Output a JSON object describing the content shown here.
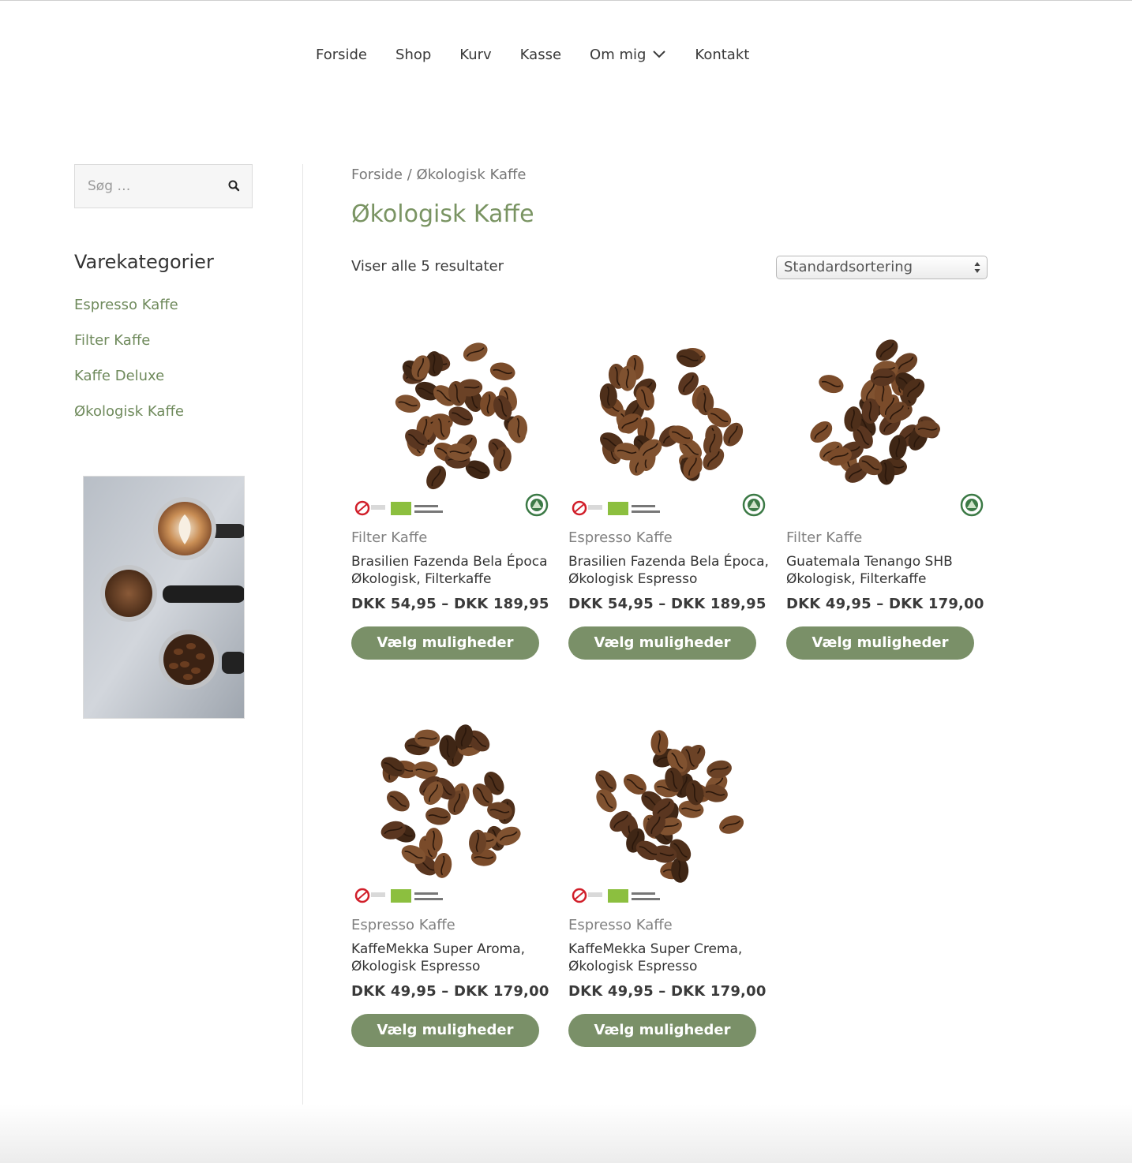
{
  "nav": {
    "items": [
      "Forside",
      "Shop",
      "Kurv",
      "Kasse",
      "Om mig",
      "Kontakt"
    ]
  },
  "sidebar": {
    "search_placeholder": "Søg …",
    "categories_heading": "Varekategorier",
    "categories": [
      "Espresso Kaffe",
      "Filter Kaffe",
      "Kaffe Deluxe",
      "Økologisk Kaffe"
    ]
  },
  "breadcrumb": {
    "home": "Forside",
    "separator": " / ",
    "current": "Økologisk Kaffe"
  },
  "page_title": "Økologisk Kaffe",
  "result_count": "Viser alle 5 resultater",
  "sort": {
    "selected": "Standardsortering"
  },
  "products": [
    {
      "category": "Filter Kaffe",
      "title": "Brasilien Fazenda Bela Época Økologisk, Filterkaffe",
      "price": "DKK 54,95 – DKK 189,95",
      "button": "Vælg muligheder"
    },
    {
      "category": "Espresso Kaffe",
      "title": "Brasilien Fazenda Bela Época, Økologisk Espresso",
      "price": "DKK 54,95 – DKK 189,95",
      "button": "Vælg muligheder"
    },
    {
      "category": "Filter Kaffe",
      "title": "Guatemala Tenango SHB Økologisk, Filterkaffe",
      "price": "DKK 49,95 – DKK 179,00",
      "button": "Vælg muligheder"
    },
    {
      "category": "Espresso Kaffe",
      "title": "KaffeMekka Super Aroma, Økologisk Espresso",
      "price": "DKK 49,95 – DKK 179,00",
      "button": "Vælg muligheder"
    },
    {
      "category": "Espresso Kaffe",
      "title": "KaffeMekka Super Crema, Økologisk Espresso",
      "price": "DKK 49,95 – DKK 179,00",
      "button": "Vælg muligheder"
    }
  ],
  "colors": {
    "accent": "#7a9463",
    "button": "#7a9068",
    "link": "#6f8a5c"
  }
}
